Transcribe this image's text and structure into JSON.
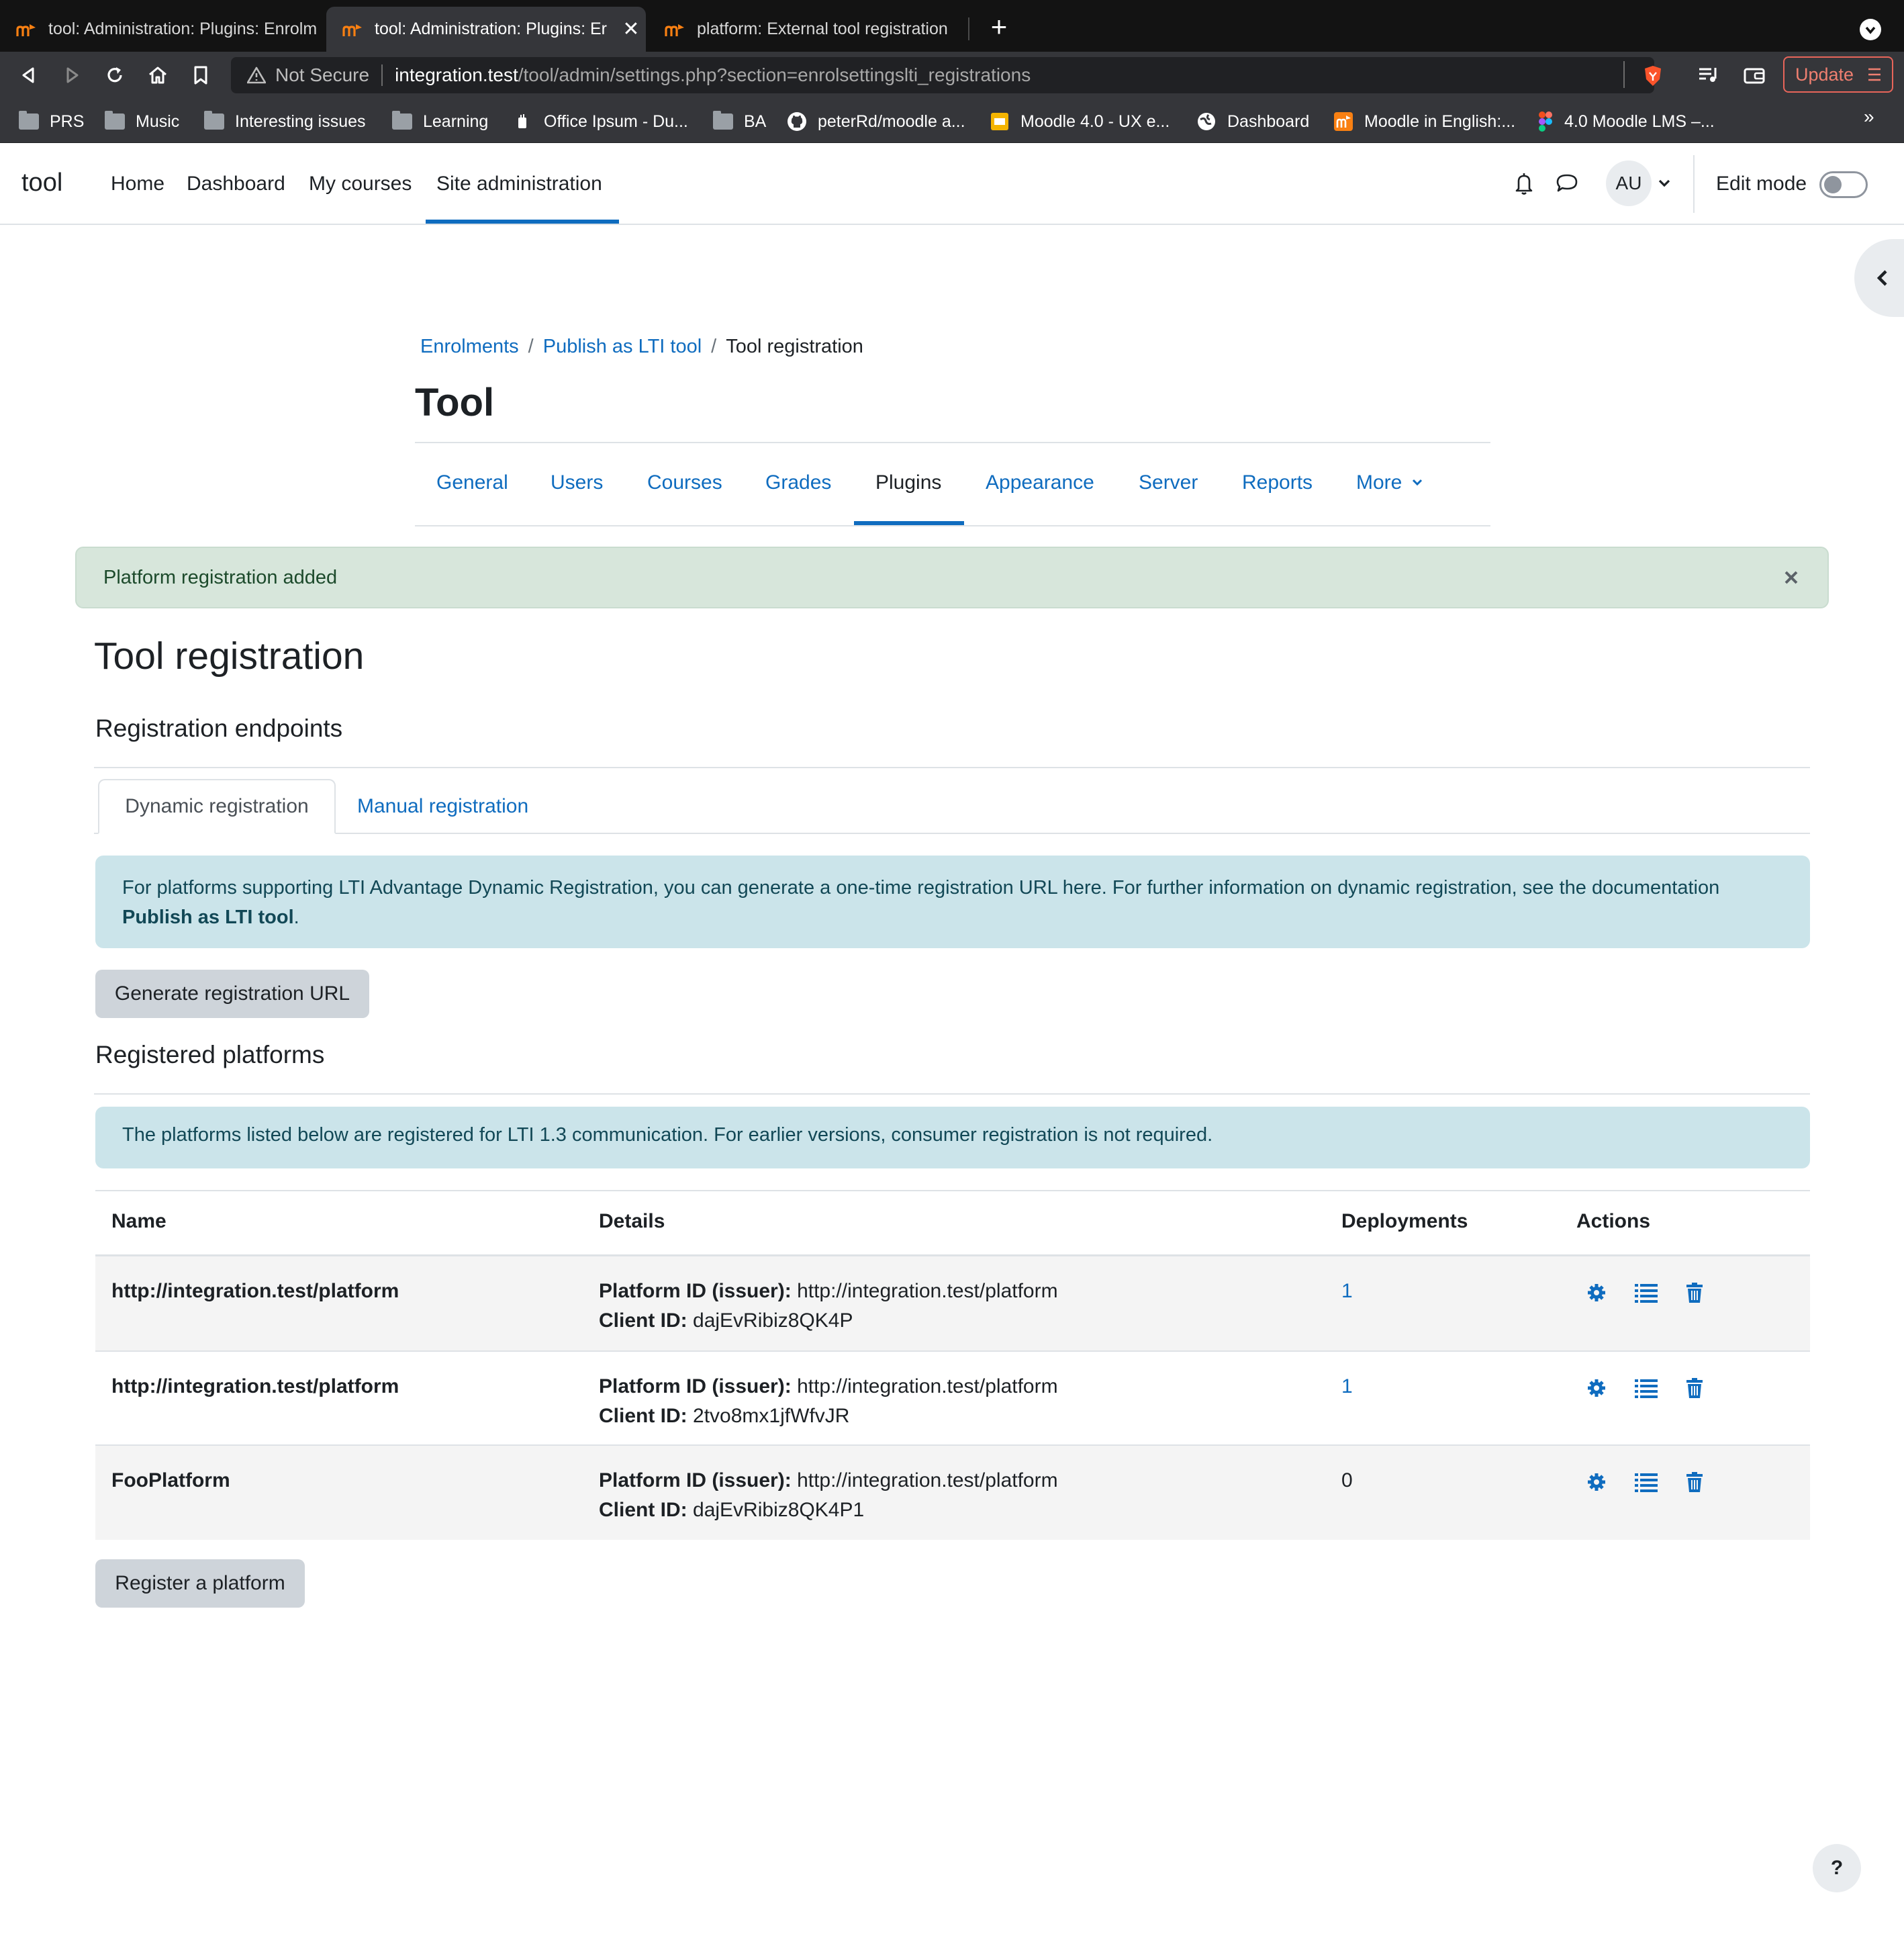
{
  "browser": {
    "tabs": [
      {
        "title": "tool: Administration: Plugins: Enrolm",
        "active": false
      },
      {
        "title": "tool: Administration: Plugins: Er",
        "active": true
      },
      {
        "title": "platform: External tool registration",
        "active": false
      }
    ],
    "security_label": "Not Secure",
    "url_host": "integration.test",
    "url_path": "/tool/admin/settings.php?section=enrolsettingslti_registrations",
    "update_label": "Update",
    "bookmarks": [
      {
        "label": "PRS",
        "icon": "folder-icon"
      },
      {
        "label": "Music",
        "icon": "folder-icon"
      },
      {
        "label": "Interesting issues",
        "icon": "folder-icon"
      },
      {
        "label": "Learning",
        "icon": "folder-icon"
      },
      {
        "label": "Office Ipsum - Du...",
        "icon": "office-ipsum-icon"
      },
      {
        "label": "BA",
        "icon": "folder-icon"
      },
      {
        "label": "peterRd/moodle a...",
        "icon": "github-icon"
      },
      {
        "label": "Moodle 4.0 - UX e...",
        "icon": "slides-icon"
      },
      {
        "label": "Dashboard",
        "icon": "globe-icon"
      },
      {
        "label": "Moodle in English:...",
        "icon": "moodle-icon"
      },
      {
        "label": "4.0 Moodle LMS –...",
        "icon": "figma-icon"
      }
    ],
    "bookmarks_overflow": "»"
  },
  "header": {
    "brand": "tool",
    "nav": [
      "Home",
      "Dashboard",
      "My courses",
      "Site administration"
    ],
    "active_nav": "Site administration",
    "avatar_initials": "AU",
    "edit_mode_label": "Edit mode",
    "edit_mode_on": false
  },
  "breadcrumb": [
    {
      "label": "Enrolments",
      "link": true
    },
    {
      "label": "Publish as LTI tool",
      "link": true
    },
    {
      "label": "Tool registration",
      "link": false
    }
  ],
  "page_title": "Tool",
  "secondary_nav": [
    "General",
    "Users",
    "Courses",
    "Grades",
    "Plugins",
    "Appearance",
    "Server",
    "Reports",
    "More"
  ],
  "secondary_nav_active": "Plugins",
  "alert_success": "Platform registration added",
  "main": {
    "heading": "Tool registration",
    "endpoints_heading": "Registration endpoints",
    "tabs": [
      "Dynamic registration",
      "Manual registration"
    ],
    "active_tab": "Dynamic registration",
    "dynamic_info_text": "For platforms supporting LTI Advantage Dynamic Registration, you can generate a one-time registration URL here. For further information on dynamic registration, see the documentation",
    "dynamic_info_link": "Publish as LTI tool",
    "dynamic_info_end": ".",
    "generate_button": "Generate registration URL",
    "registered_heading": "Registered platforms",
    "registered_info": "The platforms listed below are registered for LTI 1.3 communication. For earlier versions, consumer registration is not required.",
    "table": {
      "headers": [
        "Name",
        "Details",
        "Deployments",
        "Actions"
      ],
      "platform_id_label": "Platform ID (issuer):",
      "client_id_label": "Client ID:",
      "rows": [
        {
          "name": "http://integration.test/platform",
          "platform_id": "http://integration.test/platform",
          "client_id": "dajEvRibiz8QK4P",
          "deployments": "1",
          "deployments_link": true
        },
        {
          "name": "http://integration.test/platform",
          "platform_id": "http://integration.test/platform",
          "client_id": "2tvo8mx1jfWfvJR",
          "deployments": "1",
          "deployments_link": true
        },
        {
          "name": "FooPlatform",
          "platform_id": "http://integration.test/platform",
          "client_id": "dajEvRibiz8QK4P1",
          "deployments": "0",
          "deployments_link": false
        }
      ]
    },
    "register_button": "Register a platform"
  },
  "help_label": "?",
  "colors": {
    "link": "#0f6cbf",
    "success_bg": "#d7e6db",
    "info_bg": "#cbe4ea",
    "button_bg": "#ced4da"
  }
}
